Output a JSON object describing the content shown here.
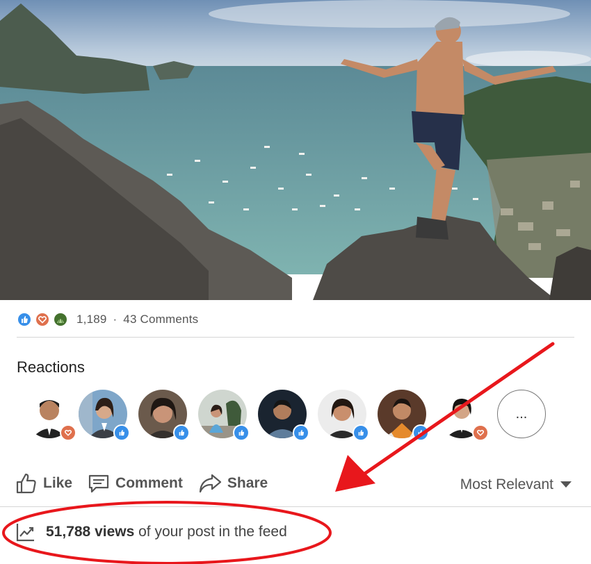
{
  "post": {
    "photo_alt": "Man standing on rocky peak above bay",
    "reaction_icons": [
      "like-icon",
      "love-icon",
      "insightful-icon"
    ],
    "reaction_count": "1,189",
    "separator": "·",
    "comment_count": "43 Comments"
  },
  "reactions": {
    "title": "Reactions",
    "people": [
      {
        "reaction": "love-icon"
      },
      {
        "reaction": "like-icon"
      },
      {
        "reaction": "like-icon"
      },
      {
        "reaction": "like-icon"
      },
      {
        "reaction": "like-icon"
      },
      {
        "reaction": "like-icon"
      },
      {
        "reaction": "like-icon"
      },
      {
        "reaction": "love-icon"
      }
    ],
    "more_label": "..."
  },
  "actions": {
    "like_label": "Like",
    "comment_label": "Comment",
    "share_label": "Share",
    "sort_label": "Most Relevant"
  },
  "views": {
    "count": "51,788 views",
    "suffix": "of your post in the feed"
  },
  "colors": {
    "like_blue": "#0a66c2",
    "love_red": "#d9534f",
    "annotation_red": "#e8171c"
  }
}
